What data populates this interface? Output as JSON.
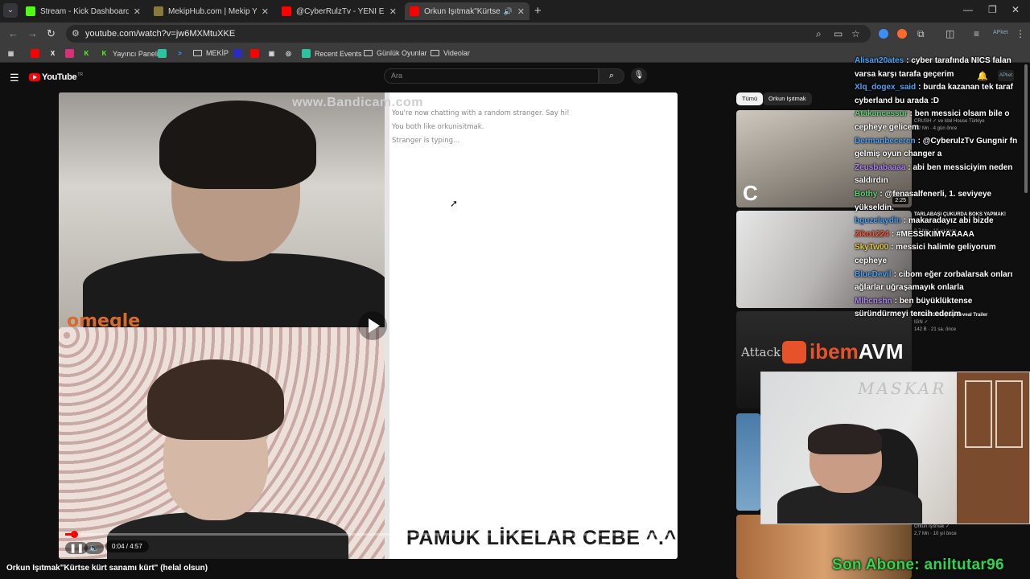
{
  "browser": {
    "tabs": [
      {
        "title": "Stream - Kick Dashboard",
        "color": "#53fc18",
        "active": false
      },
      {
        "title": "MekipHub.com | Mekip Yayıncı",
        "color": "#8a7a3a",
        "active": false
      },
      {
        "title": "@CyberRulzTv - YENİ ERKEK M",
        "color": "#ff0000",
        "active": false
      },
      {
        "title": "Orkun Işıtmak\"Kürtse kürt sa",
        "color": "#ff0000",
        "active": true
      }
    ],
    "url": "youtube.com/watch?v=jw6MXMtuXKE",
    "bookmarks": {
      "yayinci": "Yayıncı Paneli",
      "mekip": "MEKİP",
      "recent": "Recent Events",
      "gunluk": "Günlük Oyunlar",
      "videolar": "Videolar"
    }
  },
  "youtube": {
    "logo": "YouTube",
    "logo_tr": "TR",
    "search_placeholder": "Ara",
    "chips": [
      "Tümü",
      "Orkun Işıtmak"
    ],
    "avatar_text": "APket"
  },
  "video": {
    "title": "Orkun Işıtmak\"Kürtse kürt sanamı kürt\" (helal olsun)",
    "time": "0:04 / 4:57",
    "progress": 0.014,
    "watermark": "www.Bandicam.com",
    "omegle_logo": "omegle",
    "chat_lines": [
      "You're now chatting with a random stranger. Say hi!",
      "You both like orkunisitmak.",
      "Stranger is typing..."
    ],
    "overlay_caption": "PAMUK LİKELAR CEBE ^.^"
  },
  "sidebar": {
    "items": [
      {
        "meta": [
          "CRUSH ✓ ve Idol House Türkiye",
          "2,2 Mn · 4 gün önce"
        ],
        "duration": "2:25"
      },
      {
        "meta": [
          "TARLABAŞI ÇUKURDA BOKS YAPMAK!",
          "2,7 Mn · 10 yıl önce"
        ],
        "duration": ""
      },
      {
        "meta": [
          "Official Gameplay Reveal Trailer",
          "IGN ✓",
          "142 B · 21 sa. önce"
        ],
        "duration": ""
      },
      {
        "meta": [],
        "duration": ""
      },
      {
        "meta": [
          "Orkun Işıtmak ✓",
          "2,7 Mn · 10 yıl önce"
        ],
        "duration": ""
      }
    ]
  },
  "stream_overlay": {
    "chat": [
      {
        "user": "Alisan20ates",
        "color": "#4ea1f3",
        "text": "cyber tarafında NICS falan varsa karşı tarafa geçerim"
      },
      {
        "user": "Xlq_dogex_said",
        "color": "#4ea1f3",
        "text": "burda kazanan tek taraf cyberland bu arada :D"
      },
      {
        "user": "Atakancessur",
        "color": "#5fd37a",
        "text": "ben messici olsam bile o cepheye gelicem"
      },
      {
        "user": "Dermanbeceren",
        "color": "#4ea1f3",
        "text": "@CyberulzTv Gungnir fn gelmiş oyun changer a"
      },
      {
        "user": "Zeusbabaaaa",
        "color": "#b084f5",
        "text": "abi ben messiciyim neden saldırdın"
      },
      {
        "user": "Bothy",
        "color": "#5fd37a",
        "text": "@fenasalfenerli, 1. seviyeye yükseldin."
      },
      {
        "user": "bguzelaydin",
        "color": "#4ea1f3",
        "text": "makaradayız abi bizde"
      },
      {
        "user": "Ziko1224",
        "color": "#ff5a3c",
        "text": "#MESSIKIMYAAAAA"
      },
      {
        "user": "SkyTw00",
        "color": "#e3c84a",
        "text": "messici halimle geliyorum cepheye"
      },
      {
        "user": "BlueDevil",
        "color": "#4ea1f3",
        "text": "cibom eğer zorbalarsak onları ağlarlar uğraşamayık onlarla"
      },
      {
        "user": "Mlhcnshn",
        "color": "#b084f5",
        "text": "ben büyüklüktense süründürmeyi tercih ederim"
      }
    ],
    "sponsor": {
      "part1": "ibem",
      "part2": "AVM"
    },
    "webcam_watermark": "MASKAR",
    "son_abone": "Son Abone: aniltutar96"
  }
}
